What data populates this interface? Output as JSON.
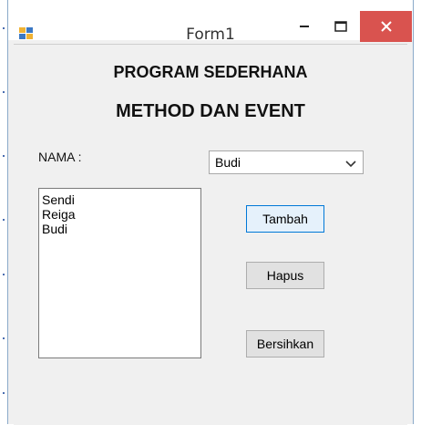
{
  "window": {
    "title": "Form1",
    "close_glyph": "✕",
    "minimize_glyph": "–",
    "maximize_glyph": "□"
  },
  "header": {
    "line1": "PROGRAM SEDERHANA",
    "line2": "METHOD DAN EVENT"
  },
  "form": {
    "nama_label": "NAMA :",
    "combo_value": "Budi",
    "list_items": [
      "Sendi",
      "Reiga",
      "Budi"
    ]
  },
  "buttons": {
    "tambah": "Tambah",
    "hapus": "Hapus",
    "bersihkan": "Bersihkan"
  },
  "colors": {
    "close_button": "#d9534f",
    "focus_border": "#0078d7"
  }
}
